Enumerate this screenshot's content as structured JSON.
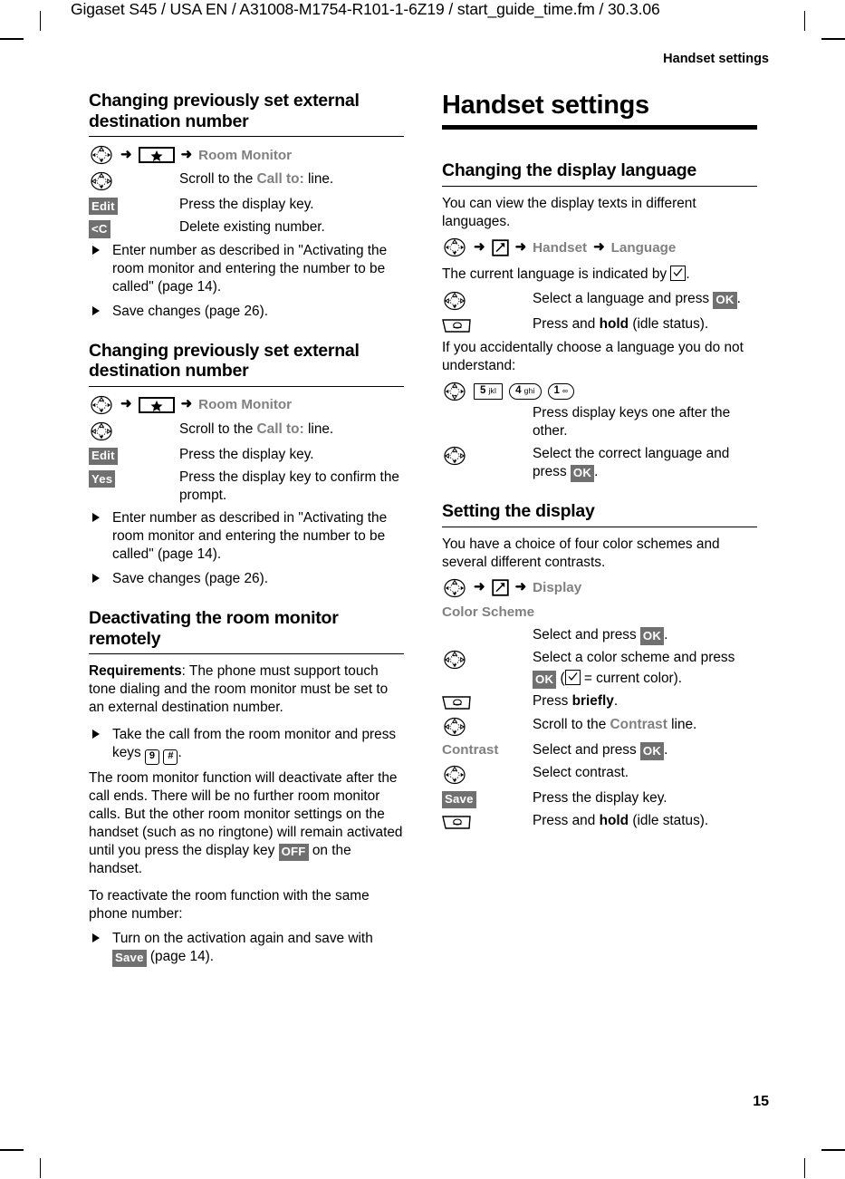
{
  "header": {
    "doc_info": "Gigaset S45 / USA EN / A31008-M1754-R101-1-6Z19 / start_guide_time.fm / 30.3.06",
    "chapter": "Handset settings"
  },
  "footer": {
    "page_number": "15"
  },
  "left_column": {
    "section1": {
      "title": "Changing previously set external destination number",
      "menu_path": {
        "key_nav": "nav-key",
        "key_star": "star-key",
        "target": "Room Monitor"
      },
      "rows": [
        {
          "key": "nav-key",
          "key_type": "nav",
          "text_pre": "Scroll to the ",
          "text_grey": "Call to:",
          "text_post": " line."
        },
        {
          "key": "Edit",
          "key_type": "display",
          "text": "Press the display key."
        },
        {
          "key": "<C",
          "key_type": "display",
          "text": "Delete existing number."
        }
      ],
      "bullets": [
        "Enter number as described in \"Activating the room monitor and entering the number to be called\" (page 14).",
        "Save changes (page 26)."
      ]
    },
    "section2": {
      "title": "Changing previously set external destination number",
      "menu_path": {
        "key_nav": "nav-key",
        "key_star": "star-key",
        "target": "Room Monitor"
      },
      "rows": [
        {
          "key": "nav-key",
          "key_type": "nav",
          "text_pre": "Scroll to the ",
          "text_grey": "Call to:",
          "text_post": " line."
        },
        {
          "key": "Edit",
          "key_type": "display",
          "text": "Press the display key."
        },
        {
          "key": "Yes",
          "key_type": "display",
          "text": "Press the display key to confirm the prompt."
        }
      ],
      "bullets": [
        "Enter number as described in \"Activating the room monitor and entering the number to be called\" (page 14).",
        "Save changes (page 26)."
      ]
    },
    "section3": {
      "title": "Deactivating the room monitor remotely",
      "req_label": "Requirements",
      "req_text": ": The phone must support touch tone dialing and the room monitor must be set to an external destination number.",
      "bullet_keys_pre": "Take the call from the room monitor and press keys ",
      "bullet_key_9": "9",
      "bullet_key_hash": "#",
      "bullet_keys_post": ".",
      "para_off_pre": "The room monitor function will deactivate after the call ends. There will be no further room monitor calls. But the other room monitor settings on the handset (such as no ringtone) will remain activated until you press the display key ",
      "para_off_key": "OFF",
      "para_off_post": " on the handset.",
      "para_reactivate": "To reactivate the room function with the same phone number:",
      "bullet_save_pre": "Turn on the activation again and save with ",
      "bullet_save_key": "Save",
      "bullet_save_post": " (page 14)."
    }
  },
  "right_column": {
    "chapter_title": "Handset settings",
    "section1": {
      "title": "Changing the display language",
      "intro": "You can view the display texts in different languages.",
      "menu_path": {
        "key_nav": "nav-key",
        "key_menu": "menu-icon",
        "item1": "Handset",
        "item2": "Language"
      },
      "indicated_pre": "The current language is indicated by ",
      "indicated_post": ".",
      "rows": [
        {
          "key_type": "nav",
          "text_pre": "Select a language and press ",
          "key_chip": "OK",
          "text_post": "."
        },
        {
          "key_type": "end",
          "text_pre": "Press and ",
          "text_bold": "hold",
          "text_post": " (idle status)."
        }
      ],
      "accident_text": "If you accidentally choose a language you do not understand:",
      "numeric_keys": [
        {
          "num": "5",
          "letters": "jkl",
          "shape": "square"
        },
        {
          "num": "4",
          "letters": "ghi",
          "shape": "round"
        },
        {
          "num": "1",
          "letters": "∞",
          "shape": "round"
        }
      ],
      "numeric_caption": "Press display keys one after the other.",
      "final_row": {
        "key_type": "nav",
        "text_pre": "Select the correct language and press ",
        "key_chip": "OK",
        "text_post": "."
      }
    },
    "section2": {
      "title": "Setting the display",
      "intro": "You have a choice of four color schemes and several different contrasts.",
      "menu_path": {
        "key_nav": "nav-key",
        "key_menu": "menu-icon",
        "item1": "Display"
      },
      "rows": [
        {
          "key_type": "label",
          "key_label": "Color Scheme",
          "text": ""
        },
        {
          "key_type": "none",
          "text_pre": "Select and press ",
          "key_chip": "OK",
          "text_post": "."
        },
        {
          "key_type": "nav",
          "text_pre": "Select a color scheme and press ",
          "key_chip": "OK",
          "text_mid": " (",
          "text_post": " = current color)."
        },
        {
          "key_type": "end",
          "text_pre": "Press ",
          "text_bold": "briefly",
          "text_post": "."
        },
        {
          "key_type": "nav",
          "text_pre": "Scroll to the ",
          "text_grey": "Contrast",
          "text_post": " line."
        },
        {
          "key_type": "label",
          "key_label": "Contrast",
          "text_pre": "Select and press ",
          "key_chip": "OK",
          "text_post": "."
        },
        {
          "key_type": "nav",
          "text_pre": "Select contrast.",
          "text_post": ""
        },
        {
          "key_type": "display",
          "key_chip_left": "Save",
          "text_pre": "Press the display key.",
          "text_post": ""
        },
        {
          "key_type": "end",
          "text_pre": "Press and ",
          "text_bold": "hold",
          "text_post": " (idle status)."
        }
      ]
    }
  },
  "colors": {
    "grey_menu_text": "#808080",
    "display_key_bg": "#707070",
    "display_key_fg": "#ffffff",
    "rule": "#000000"
  }
}
